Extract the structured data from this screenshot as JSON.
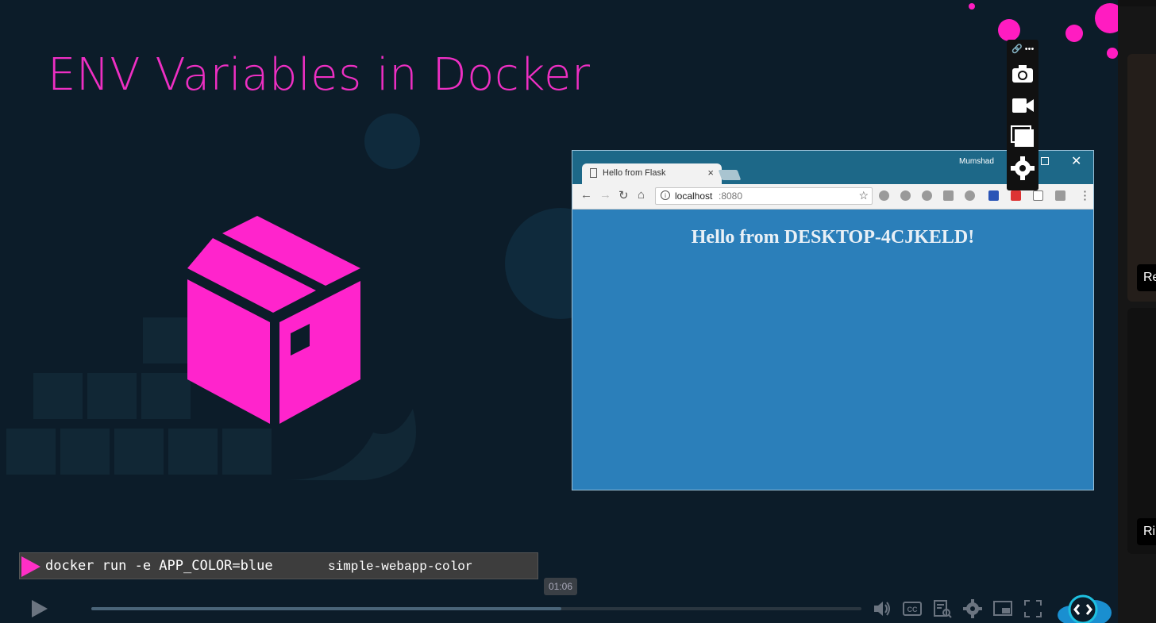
{
  "slide": {
    "title": "ENV Variables in Docker"
  },
  "browser": {
    "tab_title": "Hello from Flask",
    "tab_close": "×",
    "user": "Mumshad",
    "close": "✕",
    "url_host": "localhost",
    "url_port": ":8080",
    "heading": "Hello from DESKTOP-4CJKELD!"
  },
  "command": {
    "text": "docker run -e APP_COLOR=blue",
    "image": "simple-webapp-color"
  },
  "player": {
    "time_tooltip": "01:06",
    "progress_fraction": 0.61
  },
  "overlay": {
    "top_label": "🔗 •••"
  },
  "sidebar": {
    "items": [
      {
        "label": "Re"
      },
      {
        "label": "Ri"
      }
    ]
  },
  "colors": {
    "accent_pink": "#ff1cc1",
    "slide_bg": "#0c1c29",
    "browser_bg": "#2b7fba"
  }
}
